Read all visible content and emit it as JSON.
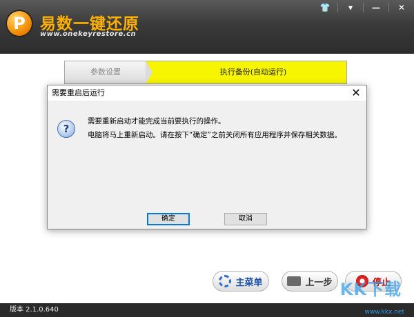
{
  "app": {
    "title": "易数一键还原",
    "url": "www.onekeyrestore.cn",
    "logo_glyph": "P"
  },
  "window_controls": {
    "shirt": "👕",
    "menu": "▾",
    "minimize": "—",
    "close": "✕"
  },
  "steps": [
    {
      "label": "参数设置",
      "active": false
    },
    {
      "label": "执行备份(自动运行)",
      "active": true
    }
  ],
  "footer": {
    "main_menu": "主菜单",
    "previous": "上一步",
    "stop": "停止",
    "version": "版本 2.1.0.640"
  },
  "watermark": {
    "text": "KK下载",
    "url": "www.kkx.net"
  },
  "dialog": {
    "title": "需要重启后运行",
    "icon": "question-icon",
    "message_line1": "需要重新启动才能完成当前要执行的操作。",
    "message_line2": "电脑将马上重新启动。请在按下“确定”之前关闭所有应用程序并保存相关数据。",
    "ok": "确定",
    "cancel": "取消",
    "close": "✕"
  },
  "colors": {
    "accent_yellow": "#f7f500",
    "title_orange": "#ffb000",
    "header_dark": "#333333"
  }
}
